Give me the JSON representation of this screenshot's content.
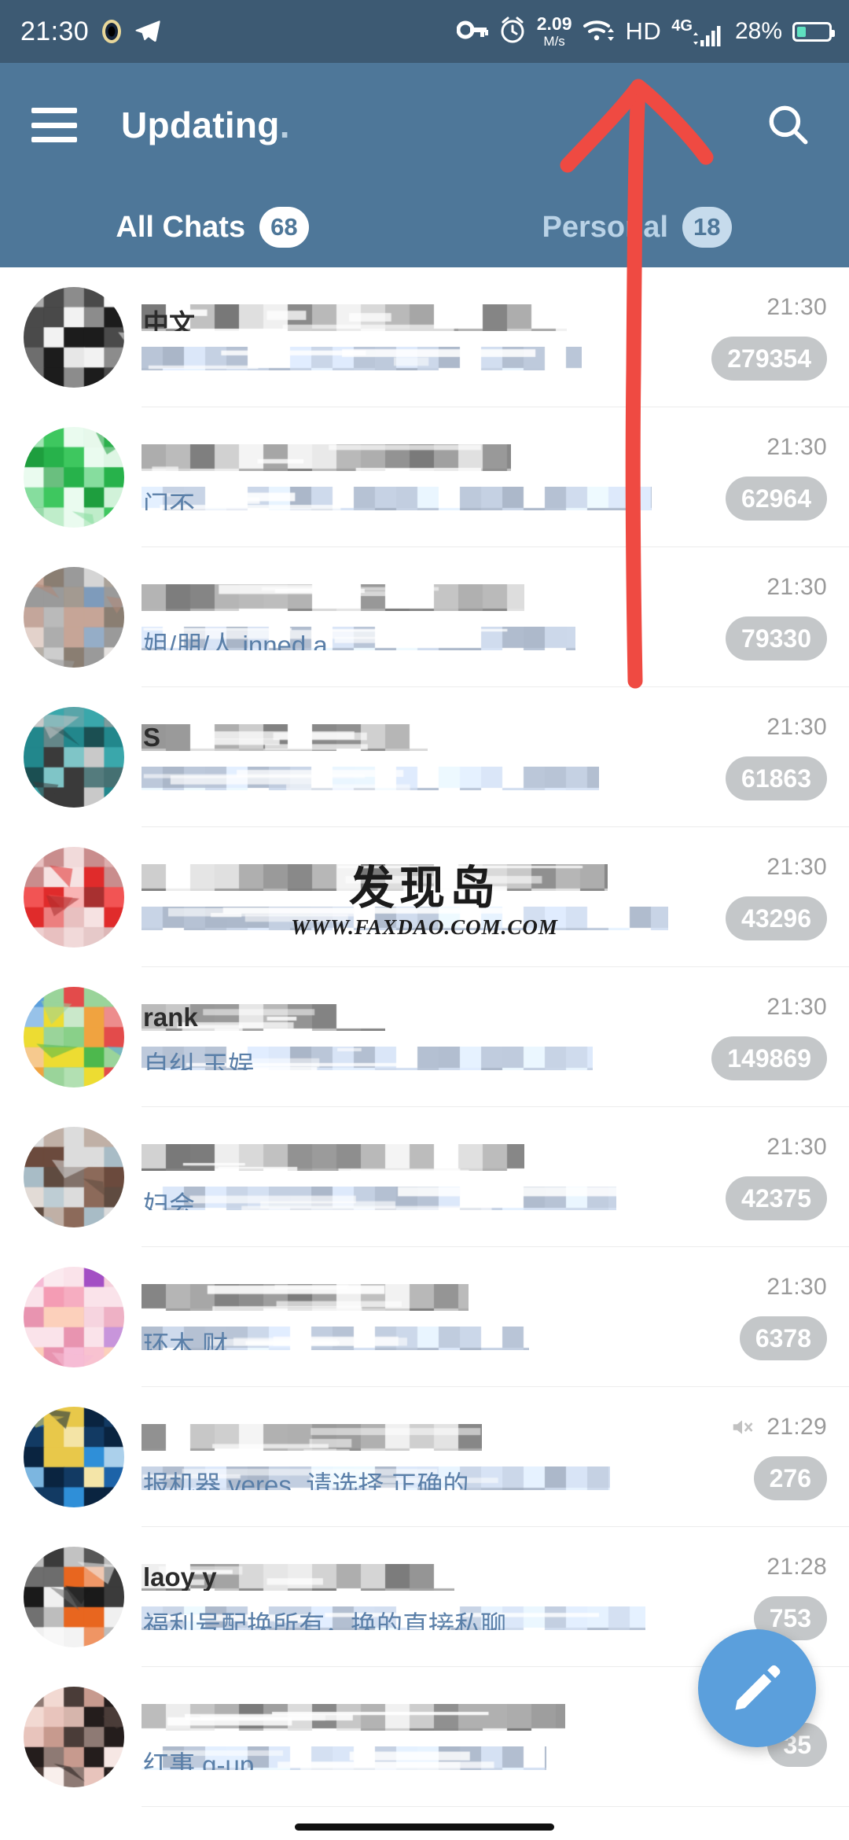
{
  "statusbar": {
    "time": "21:30",
    "network_speed_value": "2.09",
    "network_speed_unit": "M/s",
    "hd_label": "HD",
    "mobile_network": "4G",
    "battery_percent": "28%",
    "battery_level": 28,
    "icons": [
      "telegram-plane-icon",
      "vpn-key-icon",
      "alarm-clock-icon",
      "wifi-icon",
      "hd-icon",
      "signal-4g-icon",
      "battery-icon"
    ],
    "background_color": "#3d5a73"
  },
  "appbar": {
    "title": "Updating",
    "title_suffix": ".",
    "menu_icon": "hamburger-menu-icon",
    "search_icon": "search-icon",
    "background_color": "#4e7799"
  },
  "tabs": [
    {
      "label": "All Chats",
      "badge": "68",
      "active": true
    },
    {
      "label": "Personal",
      "badge": "18",
      "active": false
    }
  ],
  "chats": [
    {
      "time": "21:30",
      "unread": "279354",
      "muted": false,
      "title_redacted": true,
      "preview_redacted": true,
      "avatar_seed": 11,
      "avatar_palette": [
        "#1c1c1c",
        "#4a4a4a",
        "#8c8c8c",
        "#c9c9c9",
        "#f2f2f2",
        "#6e6e6e"
      ],
      "leak_title": "中文",
      "leak_preview": ""
    },
    {
      "time": "21:30",
      "unread": "62964",
      "muted": false,
      "title_redacted": true,
      "preview_redacted": true,
      "avatar_seed": 23,
      "avatar_palette": [
        "#27b24b",
        "#3ec75f",
        "#86dd9e",
        "#bfedca",
        "#eafbef",
        "#1e9e3e"
      ],
      "leak_title": "",
      "leak_preview": "门不"
    },
    {
      "time": "21:30",
      "unread": "79330",
      "muted": false,
      "title_redacted": true,
      "preview_redacted": true,
      "avatar_seed": 37,
      "avatar_palette": [
        "#5a7fa8",
        "#8a7e72",
        "#c6a597",
        "#d8d3cf",
        "#9a9a9a",
        "#b08878"
      ],
      "leak_title": "",
      "leak_preview": "姐/朋/人  inned a..."
    },
    {
      "time": "21:30",
      "unread": "61863",
      "muted": false,
      "title_redacted": true,
      "preview_redacted": true,
      "avatar_seed": 41,
      "avatar_palette": [
        "#1b4f52",
        "#22878c",
        "#3aa7ab",
        "#7fc5c7",
        "#3a3a3a",
        "#c9c9c9"
      ],
      "leak_title": "S",
      "leak_preview": ""
    },
    {
      "time": "21:30",
      "unread": "43296",
      "muted": false,
      "title_redacted": true,
      "preview_redacted": true,
      "avatar_seed": 53,
      "avatar_palette": [
        "#e02b2b",
        "#f25454",
        "#c98d8d",
        "#e8c0c0",
        "#f6e2e2",
        "#a83030"
      ],
      "leak_title": "",
      "leak_preview": ""
    },
    {
      "time": "21:30",
      "unread": "149869",
      "muted": false,
      "title_redacted": true,
      "preview_redacted": true,
      "avatar_seed": 67,
      "avatar_palette": [
        "#e34b4b",
        "#f0a340",
        "#eddc32",
        "#4db84d",
        "#5b9fdc",
        "#9ad49a"
      ],
      "leak_title": "rank",
      "leak_preview": "自纠          玉娱…"
    },
    {
      "time": "21:30",
      "unread": "42375",
      "muted": false,
      "title_redacted": true,
      "preview_redacted": true,
      "avatar_seed": 71,
      "avatar_palette": [
        "#6b4a3d",
        "#8c6a5a",
        "#c0b0a6",
        "#a8bcc6",
        "#dcdcdc",
        "#5f4b40"
      ],
      "leak_title": "",
      "leak_preview": "妇会"
    },
    {
      "time": "21:30",
      "unread": "6378",
      "muted": false,
      "title_redacted": true,
      "preview_redacted": true,
      "avatar_seed": 83,
      "avatar_palette": [
        "#f07a9a",
        "#fcd0bb",
        "#a34fc4",
        "#f6bcd6",
        "#fae3ea",
        "#e894b0"
      ],
      "leak_title": "",
      "leak_preview": "环木                财…"
    },
    {
      "time": "21:29",
      "unread": "276",
      "muted": true,
      "title_redacted": true,
      "preview_redacted": true,
      "avatar_seed": 97,
      "avatar_palette": [
        "#123a63",
        "#1d63a8",
        "#2f8fd8",
        "#7cb6e0",
        "#e8c84a",
        "#0a2440"
      ],
      "leak_title": "",
      "leak_preview": "报机器      veres, 请选择 正确的…"
    },
    {
      "time": "21:28",
      "unread": "753",
      "muted": false,
      "title_redacted": true,
      "preview_redacted": true,
      "avatar_seed": 103,
      "avatar_palette": [
        "#1a1a1a",
        "#3b3b3b",
        "#e8661f",
        "#bdbdbd",
        "#f0f0f0",
        "#6e6e6e"
      ],
      "leak_title": "laoy  y",
      "leak_preview": "福利号配换所有，换的直接私聊…"
    },
    {
      "time": "",
      "unread": "35",
      "muted": false,
      "title_redacted": true,
      "preview_redacted": true,
      "avatar_seed": 113,
      "avatar_palette": [
        "#241d1c",
        "#4a3c38",
        "#c79a8e",
        "#e8c4bc",
        "#8e7a74",
        "#f2d9d2"
      ],
      "leak_title": "",
      "leak_preview": "红事                     g-up"
    }
  ],
  "fab": {
    "icon": "pencil-compose-icon",
    "color": "#5b9fdc"
  },
  "watermark": {
    "text_cn": "发现岛",
    "url": "WWW.FAXDAO.COM.COM"
  },
  "annotation": {
    "type": "hand-drawn-red-arrow",
    "color": "#ef4a42",
    "points_to": "statusbar"
  }
}
